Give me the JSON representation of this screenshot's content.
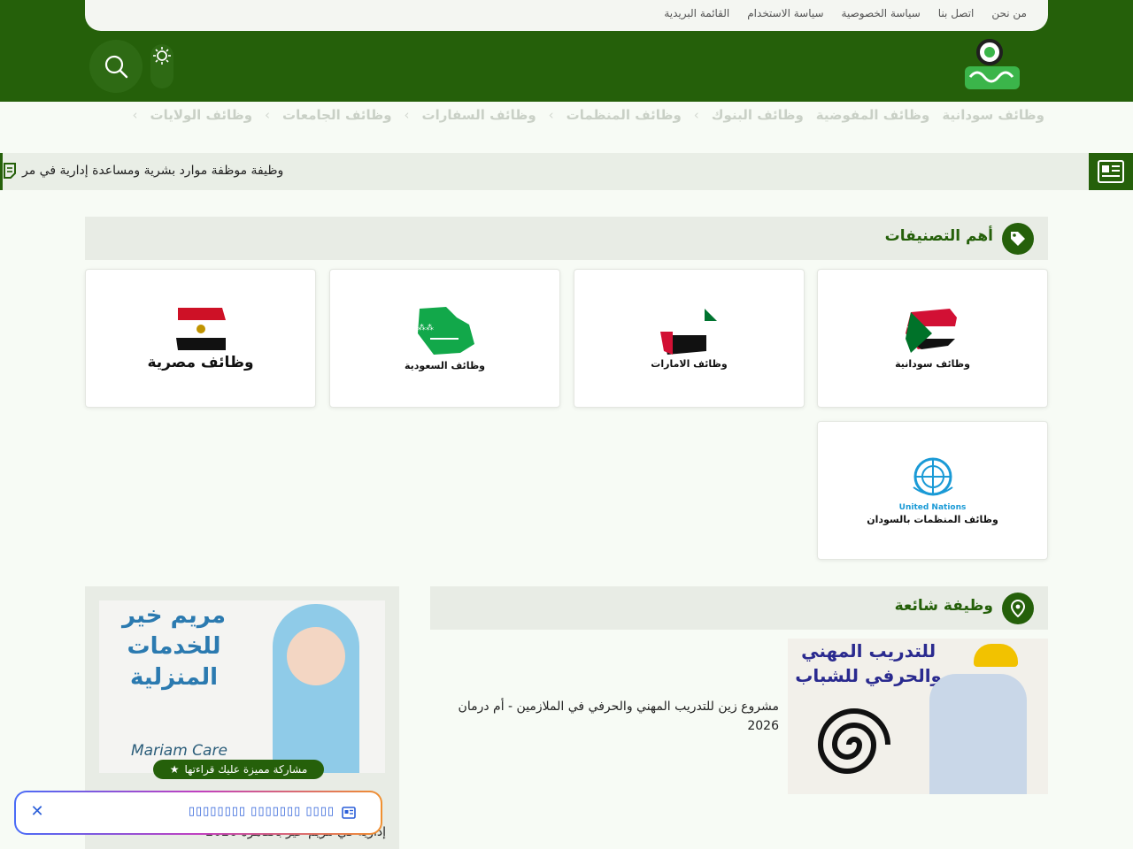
{
  "top_links": [
    "من نحن",
    "اتصل بنا",
    "سياسة الخصوصية",
    "سياسة الاستخدام",
    "القائمة البريدية"
  ],
  "categories_nav": [
    "وظائف سودانية",
    "وظائف المفوضية",
    "وظائف البنوك",
    "وظائف المنظمات",
    "وظائف السفارات",
    "وظائف الجامعات",
    "وظائف الولايات"
  ],
  "ticker": {
    "text": "وظيفة موظفة موارد بشرية ومساعدة إدارية في مر"
  },
  "top_categories": {
    "title": "أهم التصنيفات",
    "cards": [
      {
        "caption": "وظائف سودانية"
      },
      {
        "caption": "وظائف الامارات"
      },
      {
        "caption": "وظائف السعودية"
      },
      {
        "caption": "وظائف مصرية"
      },
      {
        "caption_top": "United Nations",
        "caption": "وظائف المنظمات بالسودان"
      }
    ]
  },
  "popular": {
    "title": "وظيفة شائعة",
    "item_title": "مشروع زين للتدريب المهني والحرفي في الملازمين - أم درمان 2026",
    "image_text_line1": "للتدريب المهني",
    "image_text_line2": "والحرفي للشباب"
  },
  "sidebar": {
    "image_text_line1": "مريم خير",
    "image_text_line2": "للخدمات",
    "image_text_line3": "المنزلية",
    "brand": "Mariam Care",
    "badge": "مشاركة مميزة عليك قراءتها",
    "title": "إدارية في مريم خير بالقاهرة 2026"
  },
  "notice": {
    "text": "▯▯▯▯ ▯▯▯▯▯▯▯ ▯▯▯▯▯▯▯▯"
  },
  "colors": {
    "brand_green": "#25600a",
    "light_bg": "#e8ece5",
    "notice_blue": "#2b5fd9"
  }
}
